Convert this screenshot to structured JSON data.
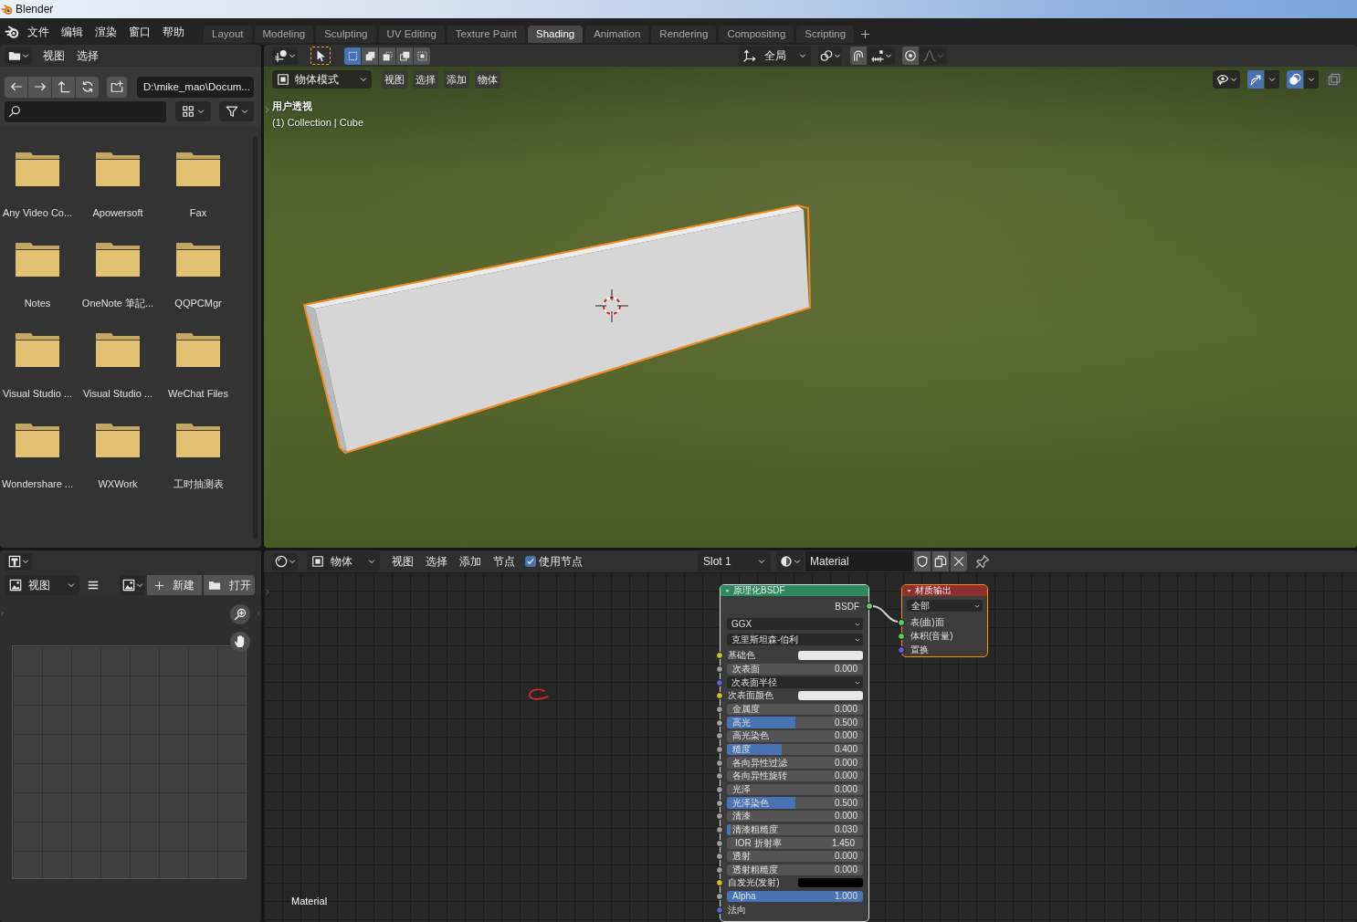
{
  "window": {
    "title": "Blender"
  },
  "menu_bar": [
    "文件",
    "编辑",
    "渲染",
    "窗口",
    "帮助"
  ],
  "workspace_tabs": [
    {
      "label": "Layout",
      "selected": false
    },
    {
      "label": "Modeling",
      "selected": false
    },
    {
      "label": "Sculpting",
      "selected": false
    },
    {
      "label": "UV Editing",
      "selected": false
    },
    {
      "label": "Texture Paint",
      "selected": false
    },
    {
      "label": "Shading",
      "selected": true
    },
    {
      "label": "Animation",
      "selected": false
    },
    {
      "label": "Rendering",
      "selected": false
    },
    {
      "label": "Compositing",
      "selected": false
    },
    {
      "label": "Scripting",
      "selected": false
    }
  ],
  "file_browser": {
    "menus": [
      "视图",
      "选择"
    ],
    "path": "D:\\mike_mao\\Docum...",
    "folders": [
      "Any Video Co...",
      "Apowersoft",
      "Fax",
      "Notes",
      "OneNote 筆記...",
      "QQPCMgr",
      "Visual Studio ...",
      "Visual Studio ...",
      "WeChat Files",
      "Wondershare ...",
      "WXWork",
      "工时抽测表"
    ]
  },
  "image_editor": {
    "view_menu": "视图",
    "new_button": "新建",
    "open_button": "打开"
  },
  "viewport": {
    "selection_modes": [
      {
        "selected": true
      },
      {
        "selected": false
      },
      {
        "selected": false
      },
      {
        "selected": false
      },
      {
        "selected": false
      }
    ],
    "transform_orientation": "全局",
    "snap": {
      "on": false
    },
    "proportional_editing": {
      "on": false
    },
    "mode": "物体模式",
    "menus": [
      "视图",
      "选择",
      "添加",
      "物体"
    ],
    "view_name": "用户透视",
    "object_info": "(1) Collection | Cube",
    "display_toggles": [
      {
        "kind": "gizmo",
        "on": true
      },
      {
        "kind": "overlay",
        "on": true
      },
      {
        "kind": "xray",
        "on": false
      }
    ]
  },
  "node_editor": {
    "object_type": "物体",
    "menus": [
      "视图",
      "选择",
      "添加",
      "节点"
    ],
    "use_nodes": {
      "label": "使用节点",
      "checked": true
    },
    "slot": "Slot 1",
    "material": "Material",
    "tree_label": "Material",
    "bsdf_node": {
      "title": "原理化BSDF",
      "color": "#2e8a5c",
      "selected": true,
      "active": false,
      "output": {
        "label": "BSDF",
        "socket": {
          "color": "#63c763"
        }
      },
      "distribution": "GGX",
      "subsurface_method": "克里斯坦森-伯利",
      "inputs": [
        {
          "kind": "color",
          "label": "基础色",
          "socket": {
            "color": "#c7c729"
          },
          "color": "#e8e8e8"
        },
        {
          "kind": "slider",
          "label": "次表面",
          "value": "0.000",
          "level": 0,
          "socket": {
            "color": "#a1a1a1"
          }
        },
        {
          "kind": "dropdown",
          "label": "次表面半径",
          "socket": {
            "color": "#6363c7"
          }
        },
        {
          "kind": "color",
          "label": "次表面颜色",
          "socket": {
            "color": "#c7c729"
          },
          "color": "#e8e8e8"
        },
        {
          "kind": "slider",
          "label": "金属度",
          "value": "0.000",
          "level": 0,
          "socket": {
            "color": "#a1a1a1"
          }
        },
        {
          "kind": "slider",
          "label": "高光",
          "value": "0.500",
          "level": 0.5,
          "socket": {
            "color": "#a1a1a1"
          }
        },
        {
          "kind": "slider",
          "label": "高光染色",
          "value": "0.000",
          "level": 0,
          "socket": {
            "color": "#a1a1a1"
          }
        },
        {
          "kind": "slider",
          "label": "糙度",
          "value": "0.400",
          "level": 0.4,
          "socket": {
            "color": "#a1a1a1"
          }
        },
        {
          "kind": "slider",
          "label": "各向异性过滤",
          "value": "0.000",
          "level": 0,
          "socket": {
            "color": "#a1a1a1"
          }
        },
        {
          "kind": "slider",
          "label": "各向异性旋转",
          "value": "0.000",
          "level": 0,
          "socket": {
            "color": "#a1a1a1"
          }
        },
        {
          "kind": "slider",
          "label": "光泽",
          "value": "0.000",
          "level": 0,
          "socket": {
            "color": "#a1a1a1"
          }
        },
        {
          "kind": "slider",
          "label": "光泽染色",
          "value": "0.500",
          "level": 0.5,
          "socket": {
            "color": "#a1a1a1"
          }
        },
        {
          "kind": "slider",
          "label": "清漆",
          "value": "0.000",
          "level": 0,
          "socket": {
            "color": "#a1a1a1"
          }
        },
        {
          "kind": "slider",
          "label": "清漆粗糙度",
          "value": "0.030",
          "level": 0.03,
          "socket": {
            "color": "#a1a1a1"
          }
        },
        {
          "kind": "number",
          "label": "IOR 折射率",
          "value": "1.450",
          "socket": {
            "color": "#a1a1a1"
          }
        },
        {
          "kind": "slider",
          "label": "透射",
          "value": "0.000",
          "level": 0,
          "socket": {
            "color": "#a1a1a1"
          }
        },
        {
          "kind": "slider",
          "label": "透射粗糙度",
          "value": "0.000",
          "level": 0,
          "socket": {
            "color": "#a1a1a1"
          }
        },
        {
          "kind": "color",
          "label": "自发光(发射)",
          "socket": {
            "color": "#c7c729"
          },
          "color": "#000000"
        },
        {
          "kind": "slider",
          "label": "Alpha",
          "value": "1.000",
          "level": 1,
          "socket": {
            "color": "#a1a1a1"
          }
        },
        {
          "kind": "socket",
          "label": "法向",
          "socket": {
            "color": "#6363c7"
          }
        }
      ]
    },
    "output_node": {
      "title": "材质输出",
      "color": "#8e2f30",
      "selected": true,
      "active": true,
      "target": "全部",
      "inputs": [
        {
          "label": "表(曲)面",
          "socket": {
            "color": "#63c763"
          }
        },
        {
          "label": "体积(音量)",
          "socket": {
            "color": "#63c763"
          }
        },
        {
          "label": "置换",
          "socket": {
            "color": "#6363c7"
          }
        }
      ]
    }
  }
}
